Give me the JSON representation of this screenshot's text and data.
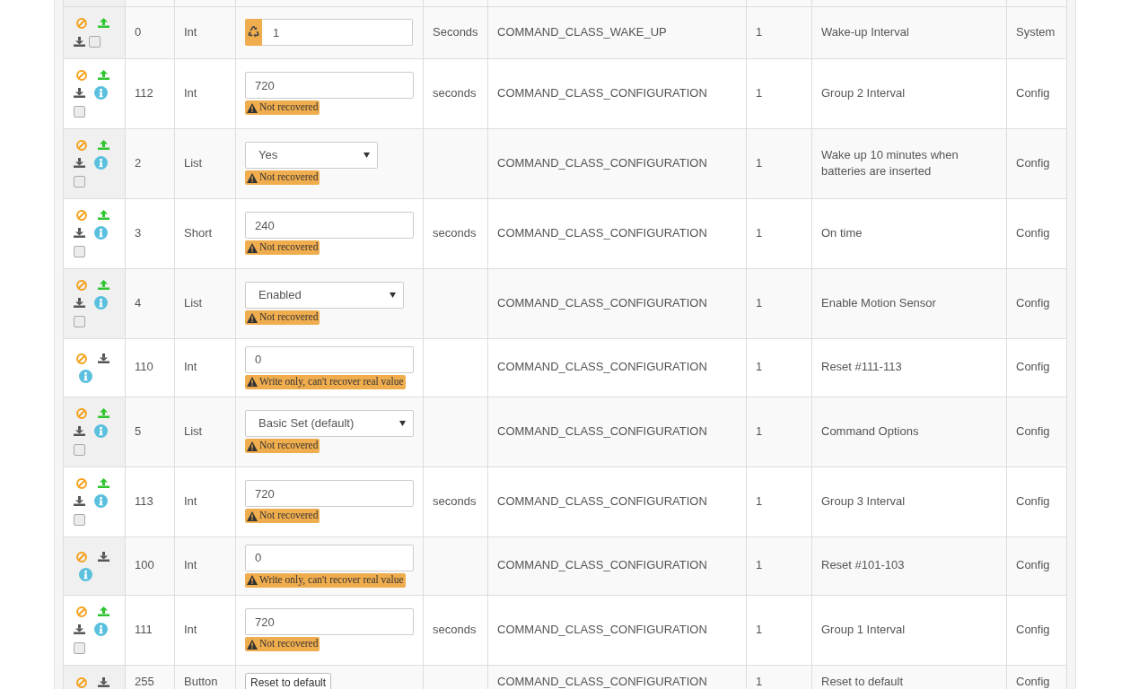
{
  "rows": [
    {
      "upload": true,
      "info": false,
      "checked": false,
      "index": "0",
      "type": "Int",
      "field": {
        "kind": "input",
        "value": "1",
        "addon": true
      },
      "units": "Seconds",
      "command_class": "COMMAND_CLASS_WAKE_UP",
      "instance": "1",
      "label": "Wake-up Interval",
      "genre": "System"
    },
    {
      "upload": true,
      "info": true,
      "checked": false,
      "index": "112",
      "type": "Int",
      "field": {
        "kind": "input",
        "value": "720",
        "addon": false
      },
      "warning": "Not recovered",
      "units": "seconds",
      "command_class": "COMMAND_CLASS_CONFIGURATION",
      "instance": "1",
      "label": "Group 2 Interval",
      "genre": "Config"
    },
    {
      "upload": true,
      "info": true,
      "checked": false,
      "index": "2",
      "type": "List",
      "field": {
        "kind": "select",
        "value": "Yes"
      },
      "warning": "Not recovered",
      "command_class": "COMMAND_CLASS_CONFIGURATION",
      "instance": "1",
      "label": "Wake up 10 minutes when batteries are inserted",
      "genre": "Config"
    },
    {
      "upload": true,
      "info": true,
      "checked": false,
      "index": "3",
      "type": "Short",
      "field": {
        "kind": "input",
        "value": "240",
        "addon": false
      },
      "warning": "Not recovered",
      "units": "seconds",
      "command_class": "COMMAND_CLASS_CONFIGURATION",
      "instance": "1",
      "label": "On time",
      "genre": "Config"
    },
    {
      "upload": true,
      "info": true,
      "checked": false,
      "index": "4",
      "type": "List",
      "field": {
        "kind": "select",
        "value": "Enabled"
      },
      "warning": "Not recovered",
      "command_class": "COMMAND_CLASS_CONFIGURATION",
      "instance": "1",
      "label": "Enable Motion Sensor",
      "genre": "Config"
    },
    {
      "upload": false,
      "info": true,
      "index": "110",
      "type": "Int",
      "field": {
        "kind": "input",
        "value": "0",
        "addon": false
      },
      "warning": "Write only, can't recover real value",
      "command_class": "COMMAND_CLASS_CONFIGURATION",
      "instance": "1",
      "label": "Reset #111-113",
      "genre": "Config"
    },
    {
      "upload": true,
      "info": true,
      "checked": false,
      "index": "5",
      "type": "List",
      "field": {
        "kind": "select",
        "value": "Basic Set (default)"
      },
      "warning": "Not recovered",
      "command_class": "COMMAND_CLASS_CONFIGURATION",
      "instance": "1",
      "label": "Command Options",
      "genre": "Config"
    },
    {
      "upload": true,
      "info": true,
      "checked": false,
      "index": "113",
      "type": "Int",
      "field": {
        "kind": "input",
        "value": "720",
        "addon": false
      },
      "warning": "Not recovered",
      "units": "seconds",
      "command_class": "COMMAND_CLASS_CONFIGURATION",
      "instance": "1",
      "label": "Group 3 Interval",
      "genre": "Config"
    },
    {
      "upload": false,
      "info": true,
      "index": "100",
      "type": "Int",
      "field": {
        "kind": "input",
        "value": "0",
        "addon": false
      },
      "warning": "Write only, can't recover real value",
      "command_class": "COMMAND_CLASS_CONFIGURATION",
      "instance": "1",
      "label": "Reset #101-103",
      "genre": "Config"
    },
    {
      "upload": true,
      "info": true,
      "checked": false,
      "index": "111",
      "type": "Int",
      "field": {
        "kind": "input",
        "value": "720",
        "addon": false
      },
      "warning": "Not recovered",
      "units": "seconds",
      "command_class": "COMMAND_CLASS_CONFIGURATION",
      "instance": "1",
      "label": "Group 1 Interval",
      "genre": "Config"
    },
    {
      "upload": false,
      "info": false,
      "index": "255",
      "type": "Button",
      "field": {
        "kind": "button",
        "label": "Reset to default"
      },
      "command_class": "COMMAND_CLASS_CONFIGURATION",
      "instance": "1",
      "label": "Reset to default",
      "genre": "Config"
    }
  ]
}
